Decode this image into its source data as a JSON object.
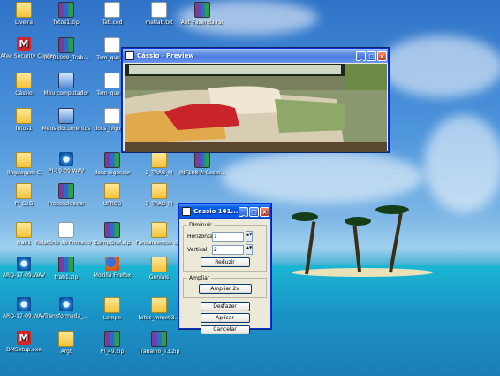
{
  "desktop_icons": [
    {
      "label": "Liveira",
      "icon": "folder-icon"
    },
    {
      "label": "fotos1.zip",
      "icon": "rar-icon"
    },
    {
      "label": "Tati.ced",
      "icon": "document-icon"
    },
    {
      "label": "matlab.txt",
      "icon": "document-icon"
    },
    {
      "label": "Ant_Fazenda.rar",
      "icon": "rar-icon"
    },
    {
      "label": "McAfee Security Center",
      "icon": "mcafee-icon"
    },
    {
      "label": "INF01009_Trab...",
      "icon": "rar-icon"
    },
    {
      "label": "Tem_que_...",
      "icon": "document-icon"
    },
    {
      "label": "Cássio",
      "icon": "folder-icon"
    },
    {
      "label": "Meu computador",
      "icon": "my-computer-icon"
    },
    {
      "label": "Tem_que_...",
      "icon": "document-icon"
    },
    {
      "label": "fotos1",
      "icon": "folder-icon"
    },
    {
      "label": "Meus documentos",
      "icon": "my-documents-icon"
    },
    {
      "label": "docs_higor_...",
      "icon": "document-icon"
    },
    {
      "label": "linguagem C",
      "icon": "folder-icon"
    },
    {
      "label": "PI-19-09.WAV",
      "icon": "wav-icon"
    },
    {
      "label": "docs higor.rar",
      "icon": "rar-icon"
    },
    {
      "label": "2_TRAB_PI",
      "icon": "folder-icon"
    },
    {
      "label": "INF108-A-Cesar...",
      "icon": "rar-icon"
    },
    {
      "label": "PI_C2G",
      "icon": "folder-icon"
    },
    {
      "label": "Protocolos.rar",
      "icon": "rar-icon"
    },
    {
      "label": "UFRGS",
      "icon": "folder-icon"
    },
    {
      "label": "3_TRAB_PI",
      "icon": "folder-icon"
    },
    {
      "label": "trab1",
      "icon": "folder-icon"
    },
    {
      "label": "Relatório do Primeiro Trabal...",
      "icon": "document-icon"
    },
    {
      "label": "CompGraf.zip",
      "icon": "rar-icon"
    },
    {
      "label": "Fundamentos_d...",
      "icon": "folder-icon"
    },
    {
      "label": "ARQ-17-09.WAV",
      "icon": "wav-icon"
    },
    {
      "label": "trab1.zip",
      "icon": "rar-icon"
    },
    {
      "label": "Mozilla Firefox",
      "icon": "firefox-icon"
    },
    {
      "label": "Geniais",
      "icon": "folder-icon"
    },
    {
      "label": "ARQ-17-09.WAV",
      "icon": "wav-icon"
    },
    {
      "label": "Transformada_...",
      "icon": "wav-icon"
    },
    {
      "label": "Lampe",
      "icon": "folder-icon"
    },
    {
      "label": "fotos_mme03...",
      "icon": "folder-icon"
    },
    {
      "label": "DMSetup.exe",
      "icon": "mcafee-icon"
    },
    {
      "label": "Argt",
      "icon": "folder-icon"
    },
    {
      "label": "PI_49.zip",
      "icon": "rar-icon"
    },
    {
      "label": "Trabalho_T3.zip",
      "icon": "rar-icon"
    }
  ],
  "preview_window": {
    "title": "Cássio - Preview",
    "minimize": "_",
    "maximize": "□",
    "close": "×"
  },
  "dialog": {
    "title": "Cassio 141...",
    "minimize": "_",
    "maximize": "□",
    "close": "×",
    "diminuir_label": "Diminuir",
    "horizontal_label": "Horizontal:",
    "horizontal_value": "1",
    "vertical_label": "Vertical:",
    "vertical_value": "2",
    "reduzir_button": "Reduzir",
    "ampliar_label": "Ampliar",
    "ampliar_button": "Ampliar 2x",
    "desfazer_button": "Desfazer",
    "aplicar_button": "Aplicar",
    "cancelar_button": "Cancelar"
  },
  "colors": {
    "titlebar_active": "#0054e3",
    "titlebar_inactive": "#7a9ce8",
    "window_bg": "#ece9d8"
  }
}
